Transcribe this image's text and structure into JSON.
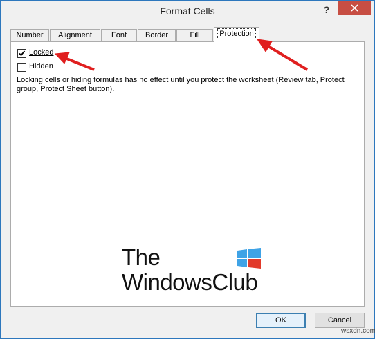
{
  "dialog": {
    "title": "Format Cells",
    "help_label": "?",
    "close_icon": "close-icon"
  },
  "tabs": [
    {
      "label": "Number",
      "active": false
    },
    {
      "label": "Alignment",
      "active": false
    },
    {
      "label": "Font",
      "active": false
    },
    {
      "label": "Border",
      "active": false
    },
    {
      "label": "Fill",
      "active": false
    },
    {
      "label": "Protection",
      "active": true
    }
  ],
  "protection": {
    "locked_label": "Locked",
    "locked_checked": true,
    "hidden_label": "Hidden",
    "hidden_checked": false,
    "description": "Locking cells or hiding formulas has no effect until you protect the worksheet (Review tab, Protect group, Protect Sheet button)."
  },
  "watermark_logo": {
    "line1": "The",
    "line2": "WindowsClub",
    "colors": {
      "blue": "#3fa3e6",
      "red": "#e23a2a"
    }
  },
  "buttons": {
    "ok_label": "OK",
    "cancel_label": "Cancel"
  },
  "site_watermark": "wsxdn.com",
  "colors": {
    "accent_border": "#2d77bd",
    "close_button": "#c74e43",
    "annotation_arrow": "#e01f1f"
  }
}
